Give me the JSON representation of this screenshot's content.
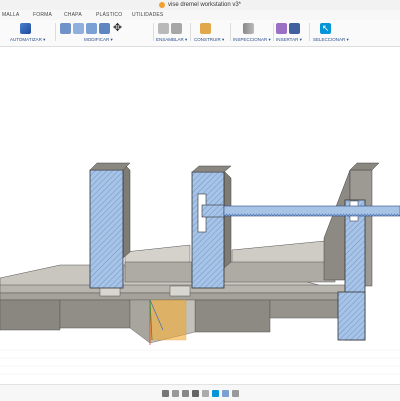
{
  "app": {
    "title": "vise dremel workstation v3*"
  },
  "tabs": [
    "MALLA",
    "FORMA",
    "CHAPA",
    "PLÁSTICO",
    "UTILIDADES"
  ],
  "toolbar": {
    "groups": [
      {
        "label": "AUTOMATIZAR ▾",
        "icons": [
          "automate-icon"
        ]
      },
      {
        "label": "MODIFICAR ▾",
        "icons": [
          "press-pull-icon",
          "fillet-icon",
          "chamfer-icon",
          "shell-icon",
          "move-icon"
        ]
      },
      {
        "label": "ENSAMBLAR ▾",
        "icons": [
          "new-component-icon",
          "joint-icon"
        ]
      },
      {
        "label": "CONSTRUIR ▾",
        "icons": [
          "offset-plane-icon"
        ]
      },
      {
        "label": "INSPECCIONAR ▾",
        "icons": [
          "measure-icon"
        ]
      },
      {
        "label": "INSERTAR ▾",
        "icons": [
          "insert-icon",
          "insert-image-icon"
        ]
      },
      {
        "label": "SELECCIONAR ▾",
        "icons": [
          "select-icon"
        ]
      }
    ]
  },
  "colors": {
    "section_blue": "#a7c3e6",
    "section_hatch": "#5a86c4",
    "body_gray": "#9d9a94",
    "body_gray_light": "#c8c5be",
    "body_gray_dark": "#7b7872",
    "outline": "#3c3c3c",
    "highlight_orange": "#f5a623",
    "accent_blue": "#0696d7"
  },
  "bottom_toolbar": {
    "icons": [
      "orbit-icon",
      "look-at-icon",
      "pan-icon",
      "zoom-icon",
      "fit-icon",
      "display-settings-icon",
      "grid-icon",
      "viewports-icon"
    ]
  }
}
